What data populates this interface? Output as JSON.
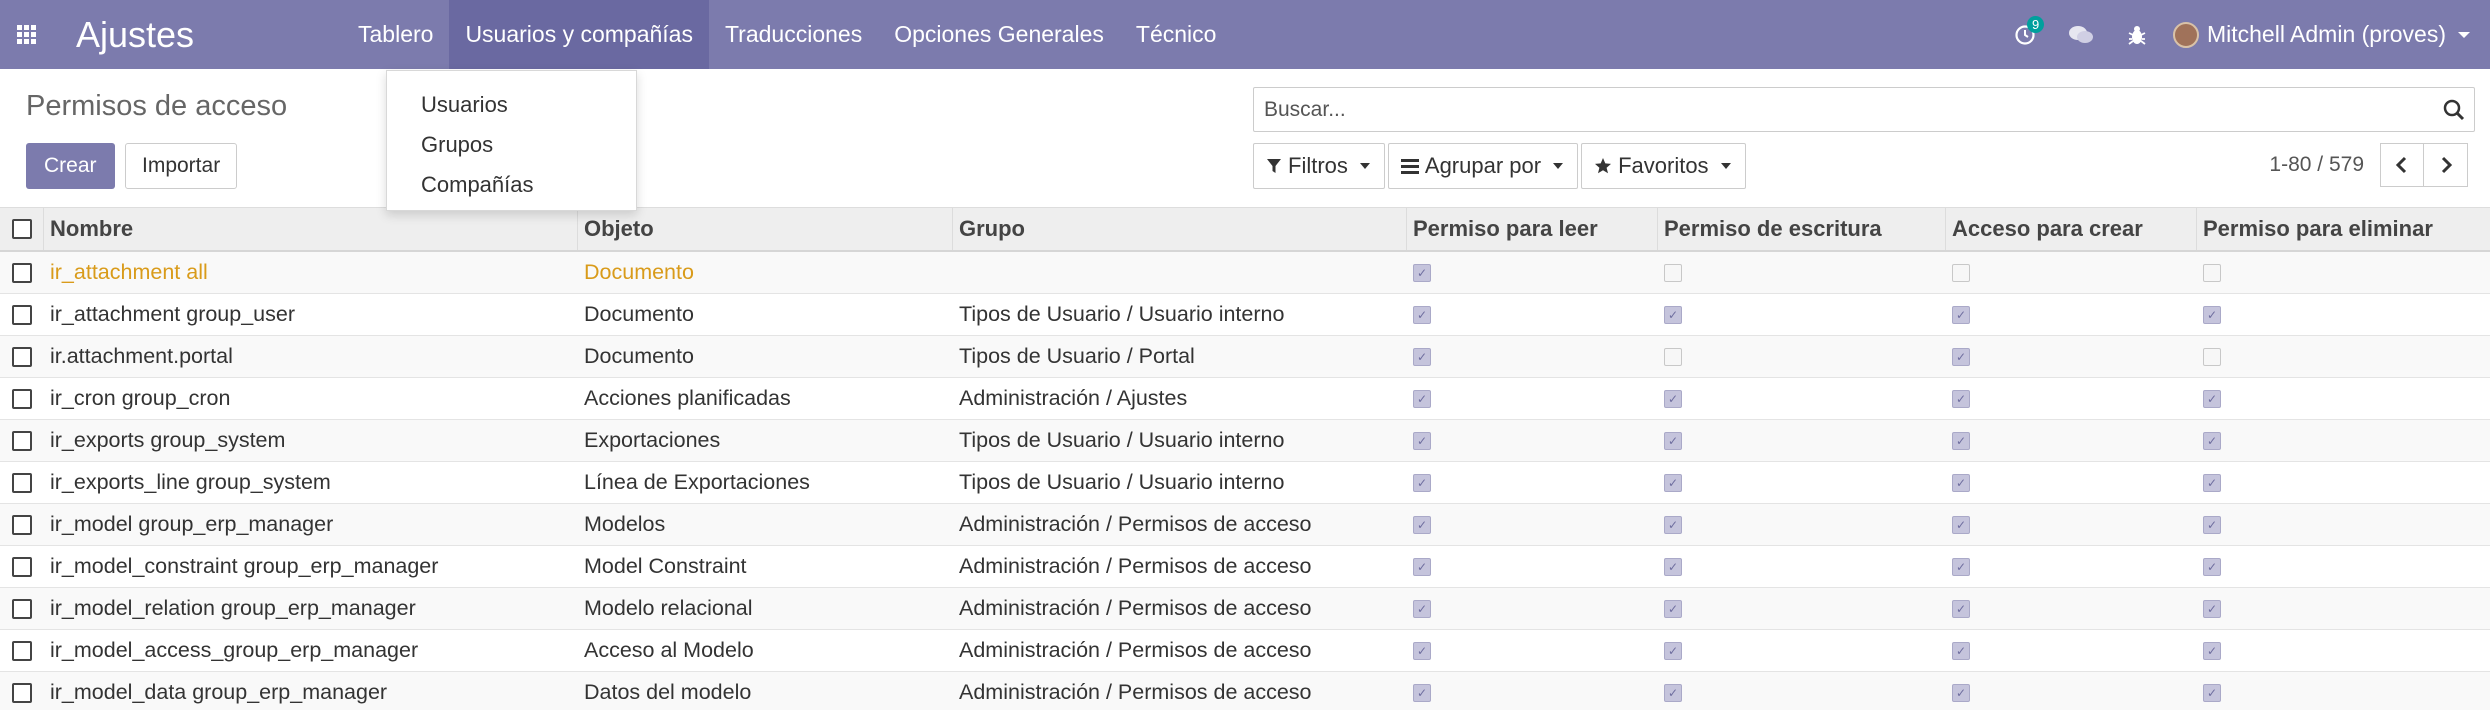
{
  "navbar": {
    "app_title": "Ajustes",
    "menu": [
      "Tablero",
      "Usuarios y compañías",
      "Traducciones",
      "Opciones Generales",
      "Técnico"
    ],
    "activity_count": "9",
    "user_name": "Mitchell Admin (proves)"
  },
  "dropdown": {
    "items": [
      "Usuarios",
      "Grupos",
      "Compañías"
    ]
  },
  "control_panel": {
    "title": "Permisos de acceso",
    "create_label": "Crear",
    "import_label": "Importar",
    "search_placeholder": "Buscar...",
    "filters_label": "Filtros",
    "groupby_label": "Agrupar por",
    "favorites_label": "Favoritos",
    "pager_value": "1-80 / 579"
  },
  "table": {
    "headers": [
      "Nombre",
      "Objeto",
      "Grupo",
      "Permiso para leer",
      "Permiso de escritura",
      "Acceso para crear",
      "Permiso para eliminar"
    ],
    "rows": [
      {
        "name": "ir_attachment all",
        "object": "Documento",
        "group": "",
        "read": true,
        "write": false,
        "create": false,
        "unlink": false
      },
      {
        "name": "ir_attachment group_user",
        "object": "Documento",
        "group": "Tipos de Usuario / Usuario interno",
        "read": true,
        "write": true,
        "create": true,
        "unlink": true
      },
      {
        "name": "ir.attachment.portal",
        "object": "Documento",
        "group": "Tipos de Usuario / Portal",
        "read": true,
        "write": false,
        "create": true,
        "unlink": false
      },
      {
        "name": "ir_cron group_cron",
        "object": "Acciones planificadas",
        "group": "Administración / Ajustes",
        "read": true,
        "write": true,
        "create": true,
        "unlink": true
      },
      {
        "name": "ir_exports group_system",
        "object": "Exportaciones",
        "group": "Tipos de Usuario / Usuario interno",
        "read": true,
        "write": true,
        "create": true,
        "unlink": true
      },
      {
        "name": "ir_exports_line group_system",
        "object": "Línea de Exportaciones",
        "group": "Tipos de Usuario / Usuario interno",
        "read": true,
        "write": true,
        "create": true,
        "unlink": true
      },
      {
        "name": "ir_model group_erp_manager",
        "object": "Modelos",
        "group": "Administración / Permisos de acceso",
        "read": true,
        "write": true,
        "create": true,
        "unlink": true
      },
      {
        "name": "ir_model_constraint group_erp_manager",
        "object": "Model Constraint",
        "group": "Administración / Permisos de acceso",
        "read": true,
        "write": true,
        "create": true,
        "unlink": true
      },
      {
        "name": "ir_model_relation group_erp_manager",
        "object": "Modelo relacional",
        "group": "Administración / Permisos de acceso",
        "read": true,
        "write": true,
        "create": true,
        "unlink": true
      },
      {
        "name": "ir_model_access_group_erp_manager",
        "object": "Acceso al Modelo",
        "group": "Administración / Permisos de acceso",
        "read": true,
        "write": true,
        "create": true,
        "unlink": true
      },
      {
        "name": "ir_model_data group_erp_manager",
        "object": "Datos del modelo",
        "group": "Administración / Permisos de acceso",
        "read": true,
        "write": true,
        "create": true,
        "unlink": true
      }
    ]
  }
}
